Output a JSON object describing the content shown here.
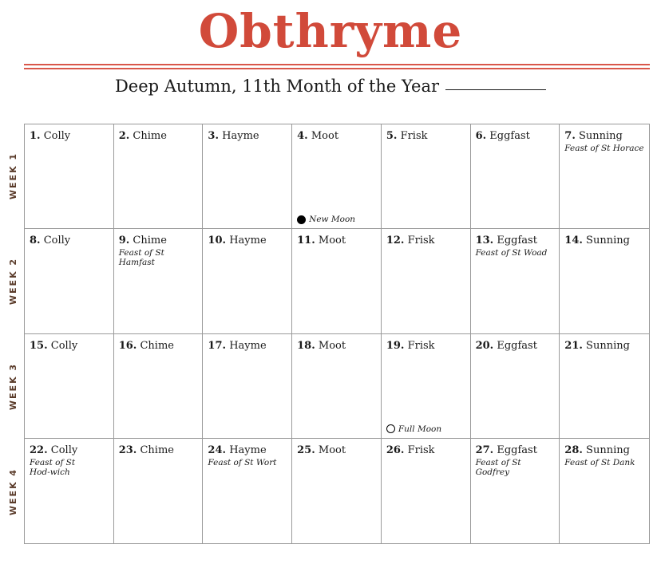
{
  "title": "Obthryme",
  "subtitle": "Deep Autumn, 11th Month of the Year",
  "colors": {
    "accent": "#d14a3a",
    "grid": "#9a9a9a",
    "week_label": "#5a3b2a"
  },
  "weeks": [
    "WEEK 1",
    "WEEK 2",
    "WEEK 3",
    "WEEK 4"
  ],
  "days": [
    {
      "num": "1.",
      "name": "Colly",
      "feast": "",
      "moon": ""
    },
    {
      "num": "2.",
      "name": "Chime",
      "feast": "",
      "moon": ""
    },
    {
      "num": "3.",
      "name": "Hayme",
      "feast": "",
      "moon": ""
    },
    {
      "num": "4.",
      "name": "Moot",
      "feast": "",
      "moon": "New Moon",
      "moon_icon": "new-moon-icon"
    },
    {
      "num": "5.",
      "name": "Frisk",
      "feast": "",
      "moon": ""
    },
    {
      "num": "6.",
      "name": "Eggfast",
      "feast": "",
      "moon": ""
    },
    {
      "num": "7.",
      "name": "Sunning",
      "feast": "Feast of St Horace",
      "moon": ""
    },
    {
      "num": "8.",
      "name": "Colly",
      "feast": "",
      "moon": ""
    },
    {
      "num": "9.",
      "name": "Chime",
      "feast": "Feast of St Hamfast",
      "moon": ""
    },
    {
      "num": "10.",
      "name": "Hayme",
      "feast": "",
      "moon": ""
    },
    {
      "num": "11.",
      "name": "Moot",
      "feast": "",
      "moon": ""
    },
    {
      "num": "12.",
      "name": "Frisk",
      "feast": "",
      "moon": ""
    },
    {
      "num": "13.",
      "name": "Eggfast",
      "feast": "Feast of St Woad",
      "moon": ""
    },
    {
      "num": "14.",
      "name": "Sunning",
      "feast": "",
      "moon": ""
    },
    {
      "num": "15.",
      "name": "Colly",
      "feast": "",
      "moon": ""
    },
    {
      "num": "16.",
      "name": "Chime",
      "feast": "",
      "moon": ""
    },
    {
      "num": "17.",
      "name": "Hayme",
      "feast": "",
      "moon": ""
    },
    {
      "num": "18.",
      "name": "Moot",
      "feast": "",
      "moon": ""
    },
    {
      "num": "19.",
      "name": "Frisk",
      "feast": "",
      "moon": "Full Moon",
      "moon_icon": "full-moon-icon"
    },
    {
      "num": "20.",
      "name": "Eggfast",
      "feast": "",
      "moon": ""
    },
    {
      "num": "21.",
      "name": "Sunning",
      "feast": "",
      "moon": ""
    },
    {
      "num": "22.",
      "name": "Colly",
      "feast": "Feast of St Hod-wich",
      "moon": ""
    },
    {
      "num": "23.",
      "name": "Chime",
      "feast": "",
      "moon": ""
    },
    {
      "num": "24.",
      "name": "Hayme",
      "feast": "Feast of St Wort",
      "moon": ""
    },
    {
      "num": "25.",
      "name": "Moot",
      "feast": "",
      "moon": ""
    },
    {
      "num": "26.",
      "name": "Frisk",
      "feast": "",
      "moon": ""
    },
    {
      "num": "27.",
      "name": "Eggfast",
      "feast": "Feast of St Godfrey",
      "moon": ""
    },
    {
      "num": "28.",
      "name": "Sunning",
      "feast": "Feast of St Dank",
      "moon": ""
    }
  ]
}
